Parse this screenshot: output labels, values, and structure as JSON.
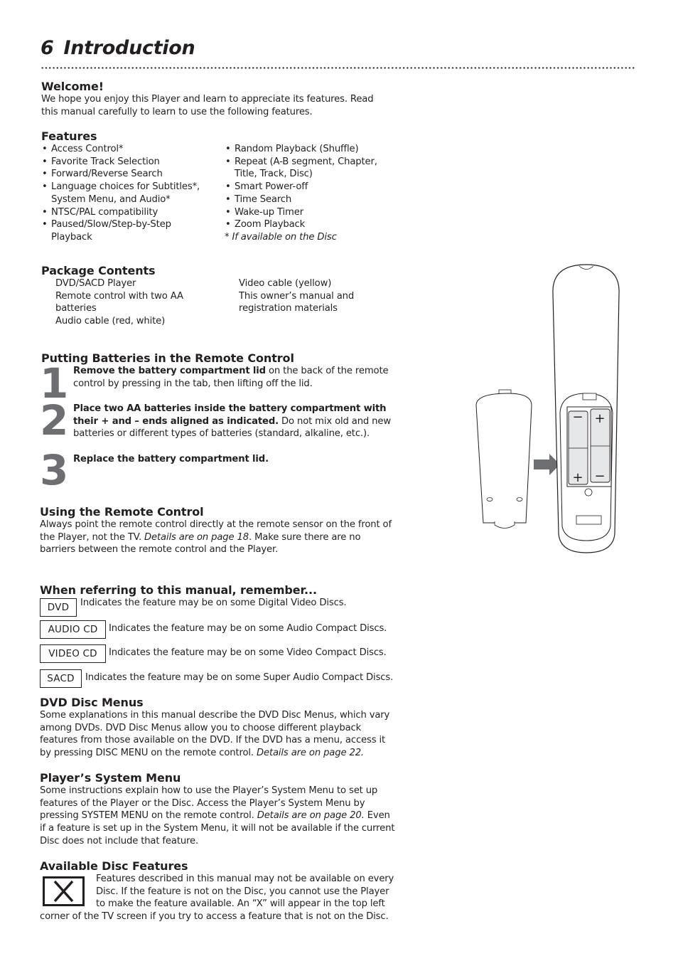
{
  "page": {
    "number": "6",
    "title": "Introduction"
  },
  "welcome": {
    "heading": "Welcome!",
    "lines": [
      "We hope you enjoy this Player and learn to appreciate its features. Read",
      "this manual carefully to learn to use the following features."
    ]
  },
  "features": {
    "heading": "Features",
    "left": [
      "Access Control*",
      "Favorite Track Selection",
      "Forward/Reverse Search",
      "Language choices for Subtitles*, System Menu, and Audio*",
      "NTSC/PAL compatibility",
      "Paused/Slow/Step-by-Step Playback"
    ],
    "right": [
      "Random Playback (Shuffle)",
      "Repeat (A-B segment, Chapter, Title, Track, Disc)",
      "Smart Power-off",
      "Time Search",
      "Wake-up Timer",
      "Zoom Playback"
    ],
    "footnote": "* If available on the Disc"
  },
  "package": {
    "heading": "Package Contents",
    "left": [
      "DVD/SACD Player",
      "Remote control with two AA batteries",
      "Audio cable (red, white)"
    ],
    "right": [
      "Video cable (yellow)",
      "This owner’s manual and registration materials"
    ]
  },
  "batteries": {
    "heading": "Putting Batteries in the Remote Control",
    "steps": [
      {
        "num": "1",
        "bold": "Remove the battery compartment lid",
        "text": " on the back of the remote control by pressing in the tab, then lifting off the lid."
      },
      {
        "num": "2",
        "bold": "Place two AA batteries inside the battery compartment with their + and – ends aligned as indicated.",
        "text": " Do not mix old and new batteries or different types of batteries (standard, alkaline, etc.)."
      },
      {
        "num": "3",
        "bold": "Replace the battery compartment lid.",
        "text": ""
      }
    ]
  },
  "using_remote": {
    "heading": "Using the Remote Control",
    "text_a": "Always point the remote control directly at the remote sensor on the front of the Player, not the TV. ",
    "ref": "Details are on page 18",
    "text_b": ". Make sure there are no barriers between the remote control and the Player."
  },
  "referring": {
    "heading": "When referring to this manual, remember...",
    "items": [
      {
        "tag": "DVD",
        "text": "Indicates the feature may be on some Digital Video Discs."
      },
      {
        "tag": "AUDIO CD",
        "text": "Indicates the feature may be on some Audio Compact Discs."
      },
      {
        "tag": "VIDEO CD",
        "text": "Indicates the feature may be on some Video Compact Discs."
      },
      {
        "tag": "SACD",
        "text": "Indicates the feature may be on some Super Audio Compact Discs."
      }
    ]
  },
  "disc_menus": {
    "heading": "DVD Disc Menus",
    "text": "Some explanations in this manual describe the DVD Disc Menus, which vary among DVDs. DVD Disc Menus allow you to choose different playback features from those available on the DVD. If the DVD has a menu, access it by pressing DISC MENU on the remote control. ",
    "ref": "Details are on page 22."
  },
  "system_menu": {
    "heading": "Player’s System Menu",
    "text_a": "Some instructions explain how to use the Player’s System Menu to set up features of the Player or the Disc. Access the Player’s System Menu by pressing SYSTEM MENU on the remote control. ",
    "ref": "Details are on page 20.",
    "text_b": " Even if a feature is set up in the System Menu, it will not be available if the current Disc does not include that feature."
  },
  "available": {
    "heading": "Available Disc Features",
    "icon_label": "X",
    "text": "Features described in this manual may not be available on every Disc. If the feature is not on the Disc, you cannot use the Player to make the feature available. An “X” will appear in the top left corner of the TV screen if you try to access a feature that is not on the Disc."
  },
  "illustration": {
    "battery_symbols": {
      "plus": "+",
      "minus": "−"
    },
    "colors": {
      "arrow": "#6d6e71",
      "battery_fill": "#e6e7e8",
      "outline": "#231f20"
    }
  }
}
